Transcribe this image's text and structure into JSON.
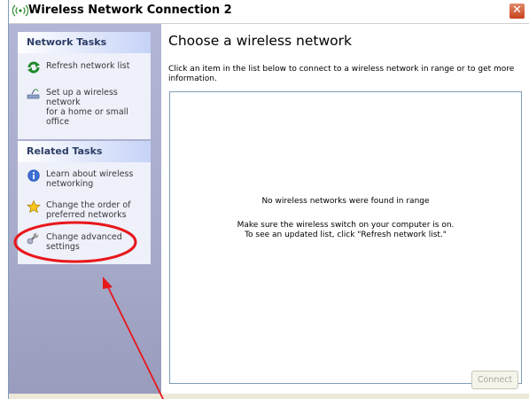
{
  "window": {
    "title": "Wireless Network Connection 2",
    "close_glyph": "✕"
  },
  "taskpane": {
    "network_tasks": {
      "heading": "Network Tasks",
      "items": [
        {
          "label_line1": "Refresh network list",
          "label_line2": "",
          "icon": "refresh-icon"
        },
        {
          "label_line1": "Set up a wireless network",
          "label_line2": "for a home or small office",
          "icon": "setup-wizard-icon"
        }
      ]
    },
    "related_tasks": {
      "heading": "Related Tasks",
      "items": [
        {
          "label_line1": "Learn about wireless",
          "label_line2": "networking",
          "icon": "info-icon"
        },
        {
          "label_line1": "Change the order of",
          "label_line2": "preferred networks",
          "icon": "star-icon"
        },
        {
          "label_line1": "Change advanced",
          "label_line2": "settings",
          "icon": "wrench-icon"
        }
      ]
    }
  },
  "main": {
    "heading": "Choose a wireless network",
    "intro_line1": "Click an item in the list below to connect to a wireless network in range or to get more",
    "intro_line2": "information.",
    "empty_message": "No wireless networks were found in range",
    "hint_line1": "Make sure the wireless switch on your computer is on.",
    "hint_line2": "To see an updated list, click \"Refresh network list.\"",
    "connect_label": "Connect"
  },
  "annotation": {
    "color": "#e8171b"
  },
  "colors": {
    "link_blue": "#215dc6",
    "pane_bg": "#a7aac9",
    "group_bg": "#eef0fa",
    "close_red": "#c8431c"
  }
}
